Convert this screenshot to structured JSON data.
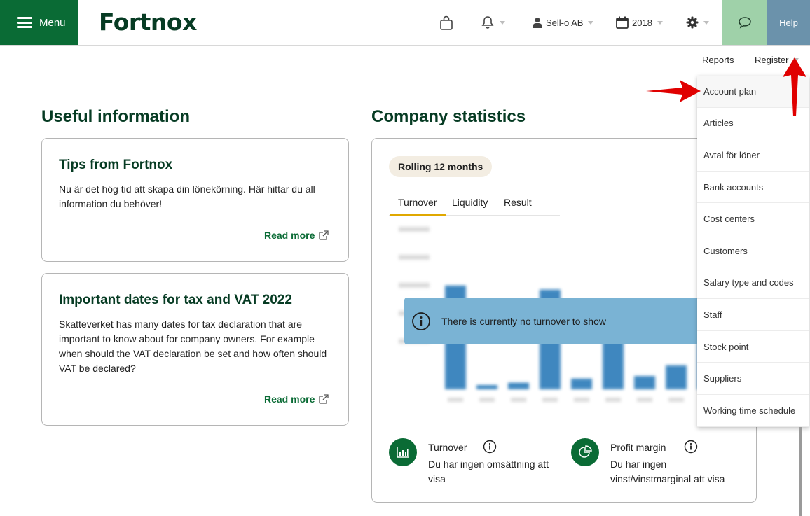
{
  "colors": {
    "brand_green": "#0a6b35",
    "dark_green": "#063b23",
    "chat_bg": "#9fd1a9",
    "help_bg": "#6b92ab",
    "notice_bg": "#7ab3d4",
    "annotation_red": "#e00000"
  },
  "header": {
    "menu_label": "Menu",
    "logo_text": "Fortnox",
    "company_label": "Sell-o AB",
    "year_label": "2018",
    "help_label": "Help",
    "icons": [
      "shopping-bag-icon",
      "bell-icon",
      "user-icon",
      "calendar-icon",
      "gear-icon",
      "chat-icon"
    ]
  },
  "subnav": {
    "reports_label": "Reports",
    "register_label": "Register"
  },
  "useful": {
    "title": "Useful information",
    "cards": [
      {
        "title": "Tips from Fortnox",
        "text": "Nu är det hög tid att skapa din lönekörning. Här hittar du all information du behöver!",
        "link": "Read more"
      },
      {
        "title": "Important dates for tax and VAT 2022",
        "text": "Skatteverket has many dates for tax declaration that are important to know about for company owners. For example when should the VAT declaration be set and how often should VAT be declared?",
        "link": "Read more"
      }
    ]
  },
  "stats": {
    "title": "Company statistics",
    "period_label": "Rolling 12 months",
    "tabs": [
      "Turnover",
      "Liquidity",
      "Result"
    ],
    "active_tab": "Turnover",
    "notice": "There is currently no turnover to show",
    "kpis": [
      {
        "title": "Turnover",
        "text": "Du har ingen omsättning att visa",
        "icon": "bar-chart-icon"
      },
      {
        "title": "Profit margin",
        "text": "Du har ingen vinst/vinstmarginal att visa",
        "icon": "pie-chart-icon"
      }
    ]
  },
  "chart_data": {
    "type": "bar",
    "blurred_placeholder": true,
    "values": [
      0.78,
      0.03,
      0.05,
      0.75,
      0.08,
      0.5,
      0.1,
      0.18,
      0.35
    ]
  },
  "register_menu": {
    "items": [
      "Account plan",
      "Articles",
      "Avtal för löner",
      "Bank accounts",
      "Cost centers",
      "Customers",
      "Salary type and codes",
      "Staff",
      "Stock point",
      "Suppliers",
      "Working time schedule"
    ]
  }
}
